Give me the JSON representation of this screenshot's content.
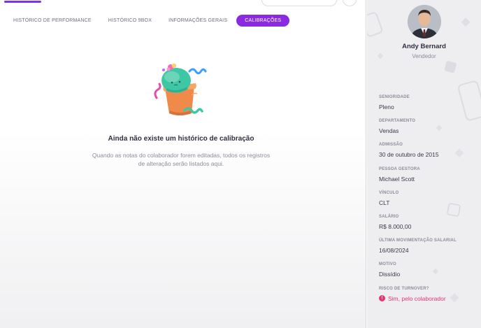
{
  "tabs": [
    {
      "label": "HISTÓRICO DE PERFORMANCE",
      "active": false
    },
    {
      "label": "HISTÓRICO 9BOX",
      "active": false
    },
    {
      "label": "INFORMAÇÕES GERAIS",
      "active": false
    },
    {
      "label": "CALIBRAÇÕES",
      "active": true
    }
  ],
  "empty_state": {
    "title": "Ainda não existe um histórico de calibração",
    "description": "Quando as notas do colaborador forem editadas, todos os registros de alteração serão listados aqui.",
    "illustration": "cactus-pot-illustration"
  },
  "profile": {
    "name": "Andy Bernard",
    "role": "Vendedor",
    "fields": [
      {
        "label": "SENIORIDADE",
        "value": "Pleno"
      },
      {
        "label": "DEPARTAMENTO",
        "value": "Vendas"
      },
      {
        "label": "ADMISSÃO",
        "value": "30 de outubro de 2015"
      },
      {
        "label": "PESSOA GESTORA",
        "value": "Michael Scott"
      },
      {
        "label": "VÍNCULO",
        "value": "CLT"
      },
      {
        "label": "SALÁRIO",
        "value": "R$ 8.000,00"
      },
      {
        "label": "ÚLTIMA MOVIMENTAÇÃO SALARIAL",
        "value": "16/08/2024"
      },
      {
        "label": "MOTIVO",
        "value": "Dissídio"
      }
    ],
    "turnover": {
      "label": "RISCO DE TURNOVER?",
      "value": "Sim, pelo colaborador",
      "icon": "alert-circle-icon"
    }
  },
  "colors": {
    "accent": "#8a2be2",
    "warning": "#e8356d"
  }
}
